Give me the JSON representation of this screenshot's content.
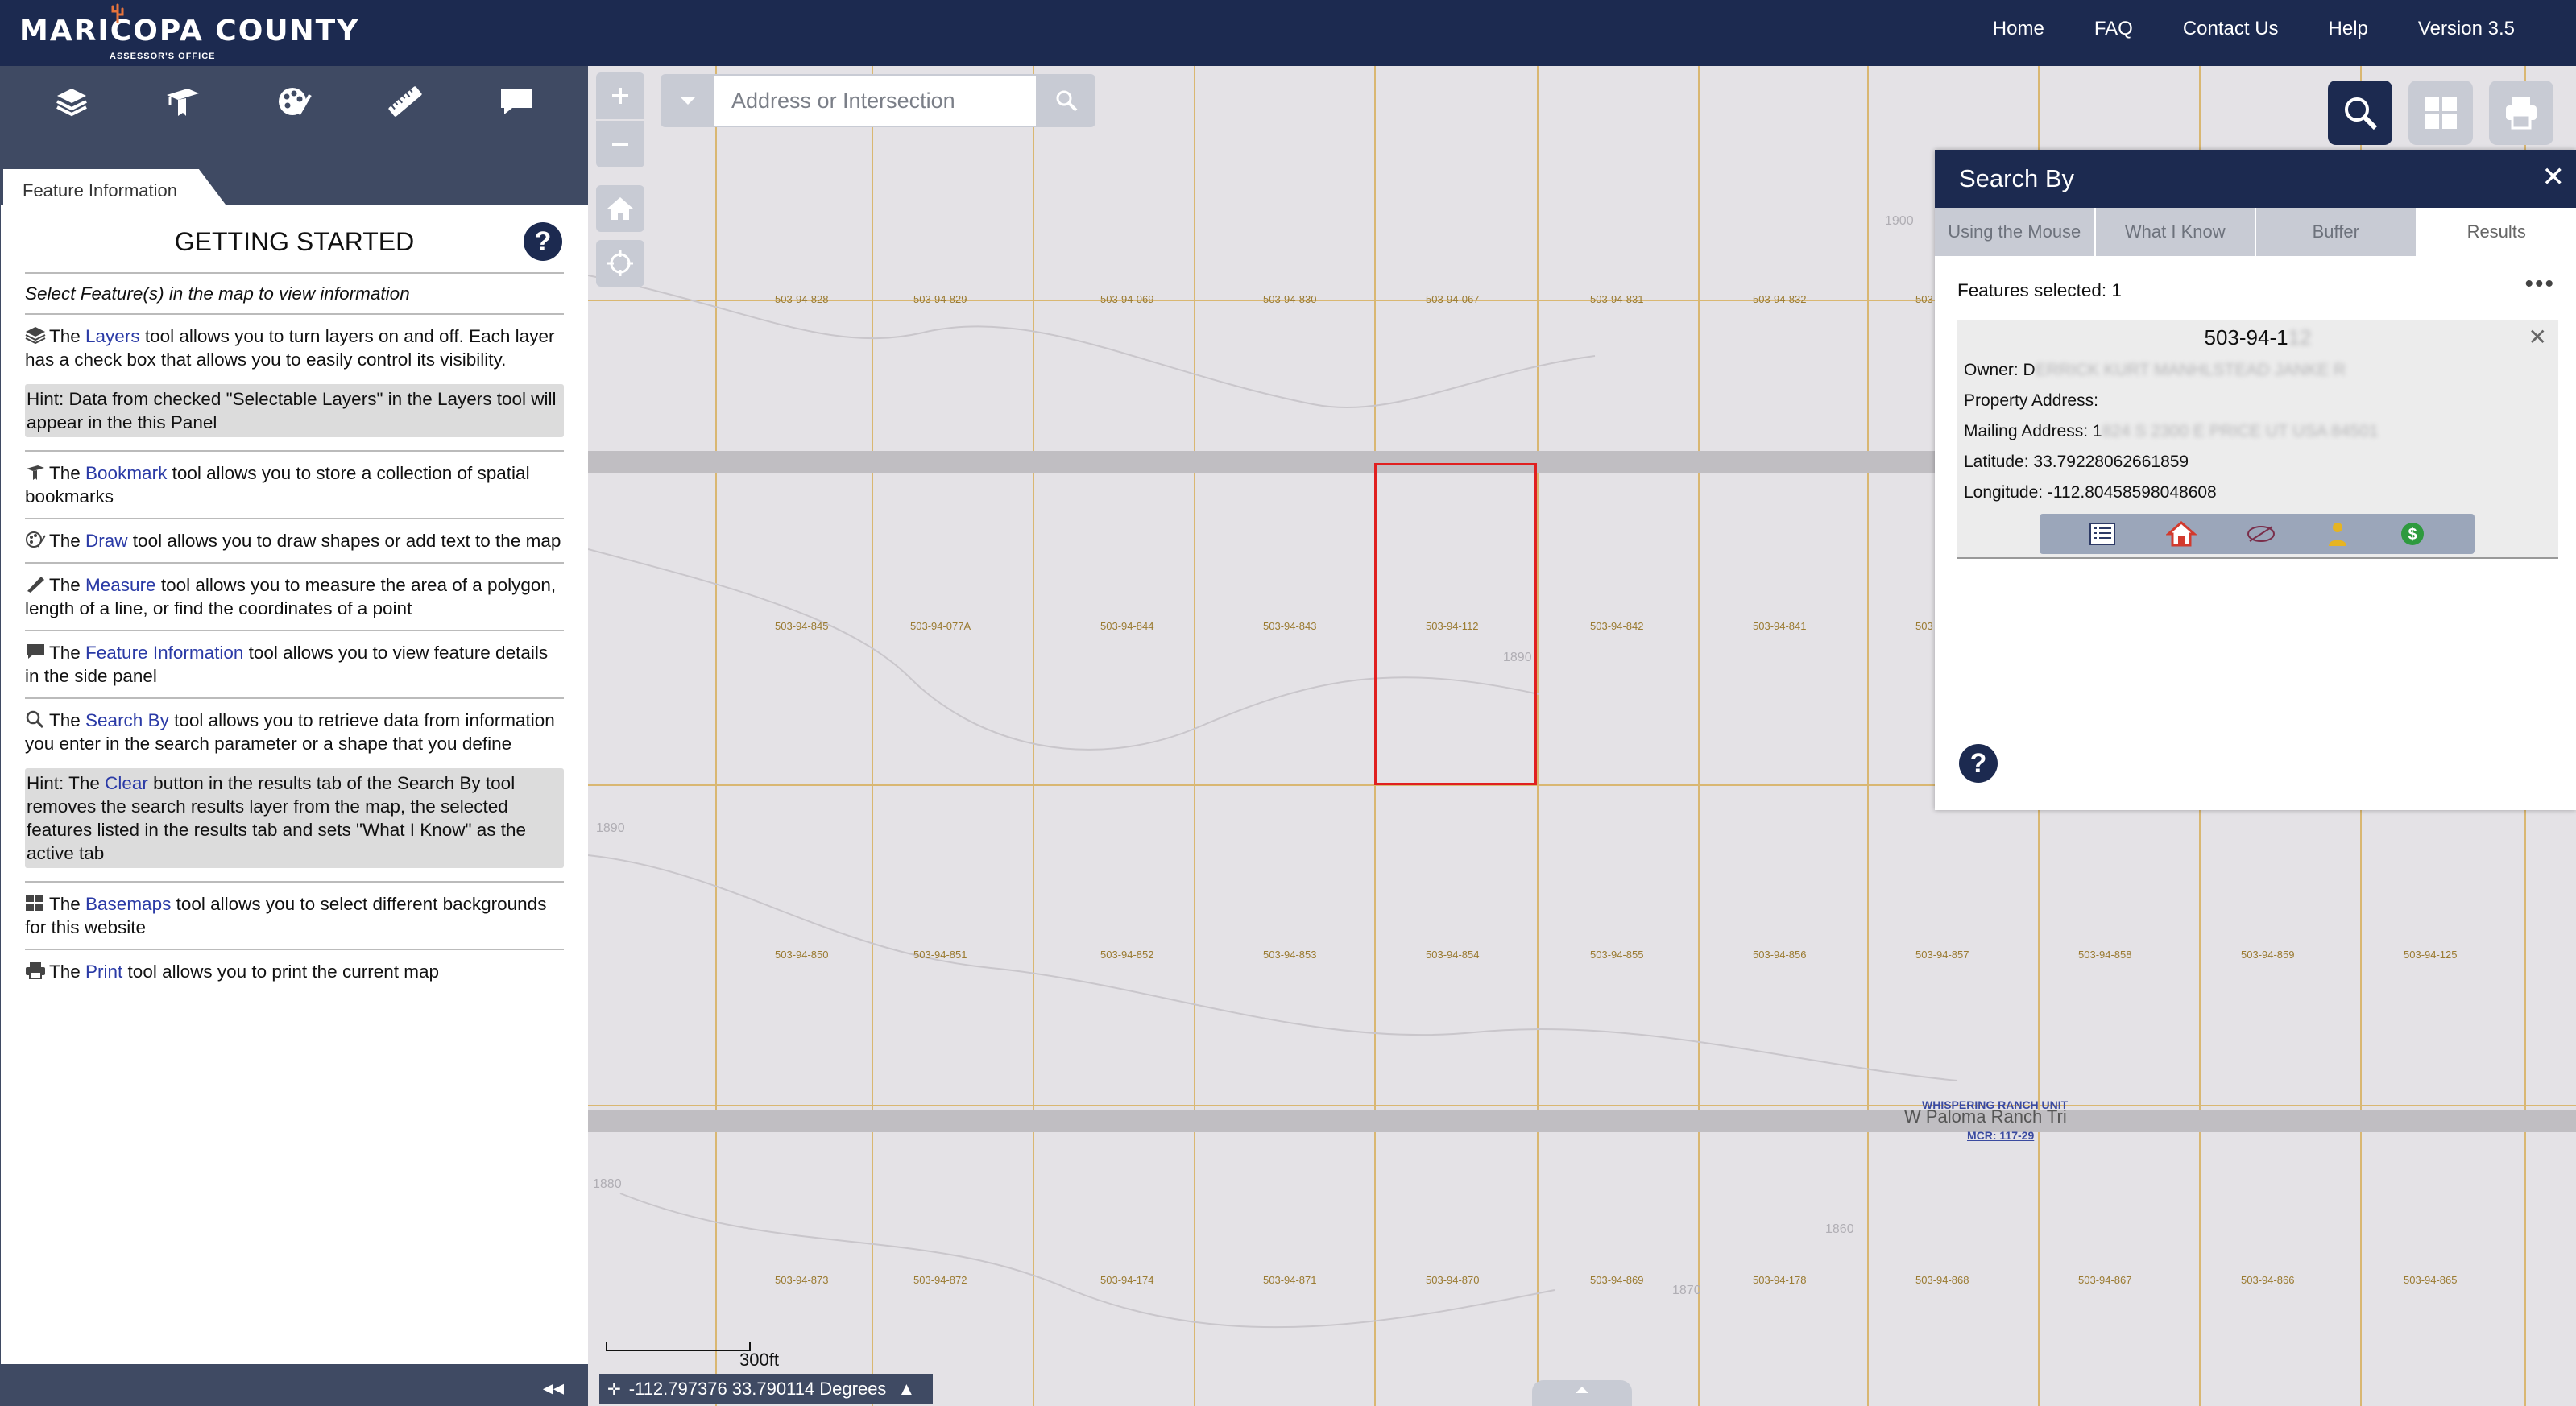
{
  "header": {
    "logo_text": "MARICOPA COUNTY",
    "logo_subtitle": "ASSESSOR'S OFFICE",
    "nav": [
      "Home",
      "FAQ",
      "Contact Us",
      "Help",
      "Version 3.5"
    ]
  },
  "left_toolbar": {
    "icons": [
      "layers-icon",
      "bookmark-icon",
      "draw-palette-icon",
      "measure-ruler-icon",
      "comment-icon"
    ]
  },
  "panel": {
    "tab_label": "Feature Information",
    "title": "GETTING STARTED",
    "help": "?",
    "intro": "Select Feature(s) in the map to view information",
    "entries": [
      {
        "link": "Layers",
        "pre": "The ",
        "post": " tool allows you to turn layers on and off. Each layer has a check box that allows you to easily control its visibility."
      },
      {
        "link": "Bookmark",
        "pre": "The ",
        "post": " tool allows you to store a collection of spatial bookmarks"
      },
      {
        "link": "Draw",
        "pre": "The ",
        "post": " tool allows you to draw shapes or add text to the map"
      },
      {
        "link": "Measure",
        "pre": "The ",
        "post": " tool allows you to measure the area of a polygon, length of a line, or find the coordinates of a point"
      },
      {
        "link": "Feature Information",
        "pre": "The ",
        "post": " tool allows you to view feature details in the side panel"
      },
      {
        "link": "Search By",
        "pre": "The ",
        "post": " tool allows you to retrieve data from information you enter in the search parameter or a shape that you define"
      },
      {
        "link": "Basemaps",
        "pre": "The ",
        "post": " tool allows you to select different backgrounds for this website"
      },
      {
        "link": "Print",
        "pre": "The ",
        "post": " tool allows you to print the current map"
      }
    ],
    "hint1": "Hint: Data from checked \"Selectable Layers\" in the Layers tool will appear in the this Panel",
    "hint2_pre": "Hint: The ",
    "hint2_link": "Clear",
    "hint2_post": " button in the results tab of the Search By tool removes the search results layer from the map, the selected features listed in the results tab and sets \"What I Know\" as the active tab",
    "collapse": "◂◂"
  },
  "map": {
    "search_placeholder": "Address or Intersection",
    "scale_label": "300ft",
    "coordinates": "-112.797376 33.790114 Degrees",
    "parcels_row1": [
      "503-94-828",
      "503-94-829",
      "503-94-069",
      "503-94-830",
      "503-94-067",
      "503-94-831",
      "503-94-832",
      "503"
    ],
    "parcels_row2": [
      "503-94-845",
      "503-94-077A",
      "503-94-844",
      "503-94-843",
      "503-94-112",
      "503-94-842",
      "503-94-841",
      "503"
    ],
    "parcels_row3": [
      "503-94-850",
      "503-94-851",
      "503-94-852",
      "503-94-853",
      "503-94-854",
      "503-94-855",
      "503-94-856",
      "503-94-857",
      "503-94-858",
      "503-94-859",
      "503-94-125"
    ],
    "parcels_row4": [
      "503-94-873",
      "503-94-872",
      "503-94-174",
      "503-94-871",
      "503-94-870",
      "503-94-869",
      "503-94-178",
      "503-94-868",
      "503-94-867",
      "503-94-866",
      "503-94-865"
    ],
    "street_label": "W Paloma Ranch Tri",
    "subdivision_label": [
      "WHISPERING RANCH UNIT",
      "MCR: 117-29"
    ],
    "contours": [
      "1900",
      "1890",
      "1890",
      "1880",
      "1870",
      "1860"
    ]
  },
  "search_panel": {
    "title": "Search By",
    "close": "✕",
    "tabs": [
      "Using the Mouse",
      "What I Know",
      "Buffer",
      "Results"
    ],
    "active_tab": "Results",
    "features_selected": "Features selected: 1",
    "more": "•••",
    "result": {
      "apn": "503-94-1",
      "apn_hidden": "12",
      "owner_label": "Owner: ",
      "owner_visible": "D",
      "owner_hidden": "ERRICK KURT MANHLSTEAD JANKE R",
      "property_address_label": "Property Address:",
      "mailing_label": "Mailing Address: ",
      "mailing_visible": "1",
      "mailing_hidden": "824 S 2300 E PRICE UT USA 84501",
      "latitude": "Latitude: 33.79228062661859",
      "longitude": "Longitude: -112.80458598048608"
    },
    "result_tools": [
      "details-list-icon",
      "property-home-icon",
      "parcel-map-icon",
      "owner-person-icon",
      "valuation-dollar-icon"
    ],
    "help": "?"
  }
}
